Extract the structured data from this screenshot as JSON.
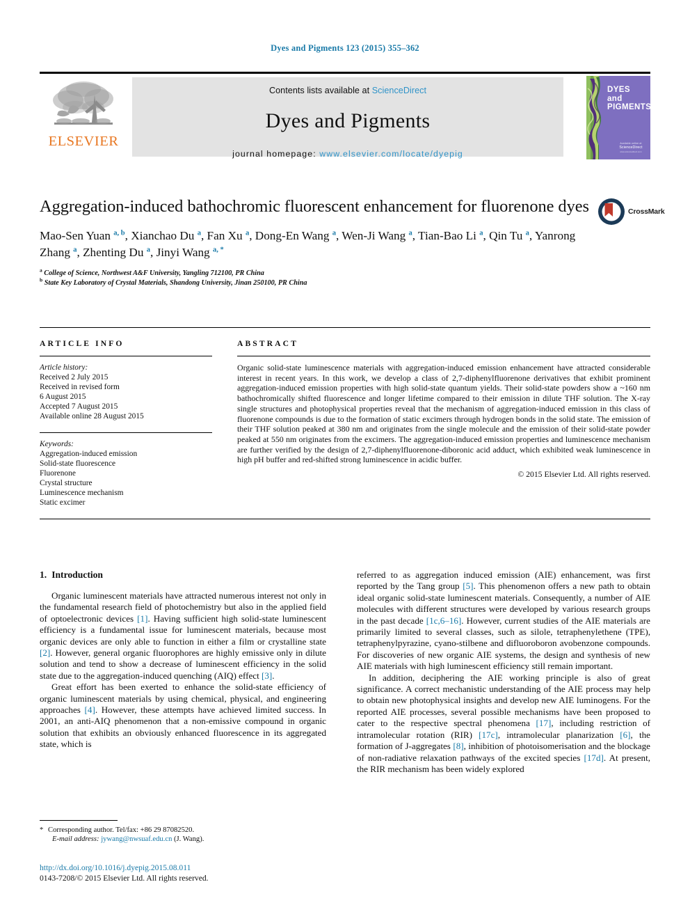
{
  "running_head": "Dyes and Pigments 123 (2015) 355–362",
  "masthead": {
    "contents_prefix": "Contents lists available at ",
    "sciencedirect": "ScienceDirect",
    "journal_title": "Dyes and Pigments",
    "homepage_prefix": "journal homepage: ",
    "homepage_url": "www.elsevier.com/locate/dyepig",
    "publisher_name": "ELSEVIER",
    "cover": {
      "line1": "DYES",
      "line2": "and",
      "line3": "PIGMENTS",
      "foot_a": "Available online at",
      "foot_b": "ScienceDirect",
      "foot_c": "www.sciencedirect.com"
    }
  },
  "article": {
    "title": "Aggregation-induced bathochromic fluorescent enhancement for fluorenone dyes",
    "authors": [
      {
        "name": "Mao-Sen Yuan",
        "sup": "a, b",
        "sep": ", "
      },
      {
        "name": "Xianchao Du",
        "sup": "a",
        "sep": ", "
      },
      {
        "name": "Fan Xu",
        "sup": "a",
        "sep": ", "
      },
      {
        "name": "Dong-En Wang",
        "sup": "a",
        "sep": ", "
      },
      {
        "name": "Wen-Ji Wang",
        "sup": "a",
        "sep": ", "
      },
      {
        "name": "Tian-Bao Li",
        "sup": "a",
        "sep": ", "
      },
      {
        "name": "Qin Tu",
        "sup": "a",
        "sep": ", "
      },
      {
        "name": "Yanrong Zhang",
        "sup": "a",
        "sep": ", "
      },
      {
        "name": "Zhenting Du",
        "sup": "a",
        "sep": ", "
      },
      {
        "name": "Jinyi Wang",
        "sup": "a, *",
        "sep": ""
      }
    ],
    "affiliations": [
      {
        "mark": "a",
        "text": "College of Science, Northwest A&F University, Yangling 712100, PR China"
      },
      {
        "mark": "b",
        "text": "State Key Laboratory of Crystal Materials, Shandong University, Jinan 250100, PR China"
      }
    ],
    "crossmark_label": "CrossMark"
  },
  "info": {
    "heading": "ARTICLE INFO",
    "history_label": "Article history:",
    "history": [
      "Received 2 July 2015",
      "Received in revised form",
      "6 August 2015",
      "Accepted 7 August 2015",
      "Available online 28 August 2015"
    ],
    "keywords_label": "Keywords:",
    "keywords": [
      "Aggregation-induced emission",
      "Solid-state fluorescence",
      "Fluorenone",
      "Crystal structure",
      "Luminescence mechanism",
      "Static excimer"
    ]
  },
  "abstract": {
    "heading": "ABSTRACT",
    "text": "Organic solid-state luminescence materials with aggregation-induced emission enhancement have attracted considerable interest in recent years. In this work, we develop a class of 2,7-diphenylfluorenone derivatives that exhibit prominent aggregation-induced emission properties with high solid-state quantum yields. Their solid-state powders show a ~160 nm bathochromically shifted fluorescence and longer lifetime compared to their emission in dilute THF solution. The X-ray single structures and photophysical properties reveal that the mechanism of aggregation-induced emission in this class of fluorenone compounds is due to the formation of static excimers through hydrogen bonds in the solid state. The emission of their THF solution peaked at 380 nm and originates from the single molecule and the emission of their solid-state powder peaked at 550 nm originates from the excimers. The aggregation-induced emission properties and luminescence mechanism are further verified by the design of 2,7-diphenylfluorenone-diboronic acid adduct, which exhibited weak luminescence in high pH buffer and red-shifted strong luminescence in acidic buffer.",
    "copyright": "© 2015 Elsevier Ltd. All rights reserved."
  },
  "body": {
    "section_number": "1.",
    "section_title": "Introduction",
    "left_paragraphs": [
      "Organic luminescent materials have attracted numerous interest not only in the fundamental research field of photochemistry but also in the applied field of optoelectronic devices [1]. Having sufficient high solid-state luminescent efficiency is a fundamental issue for luminescent materials, because most organic devices are only able to function in either a film or crystalline state [2]. However, general organic fluorophores are highly emissive only in dilute solution and tend to show a decrease of luminescent efficiency in the solid state due to the aggregation-induced quenching (AIQ) effect [3].",
      "Great effort has been exerted to enhance the solid-state efficiency of organic luminescent materials by using chemical, physical, and engineering approaches [4]. However, these attempts have achieved limited success. In 2001, an anti-AIQ phenomenon that a non-emissive compound in organic solution that exhibits an obviously enhanced fluorescence in its aggregated state, which is"
    ],
    "right_paragraphs": [
      "referred to as aggregation induced emission (AIE) enhancement, was first reported by the Tang group [5]. This phenomenon offers a new path to obtain ideal organic solid-state luminescent materials. Consequently, a number of AIE molecules with different structures were developed by various research groups in the past decade [1c,6–16]. However, current studies of the AIE materials are primarily limited to several classes, such as silole, tetraphenylethene (TPE), tetraphenylpyrazine, cyano-stilbene and difluoroboron avobenzone compounds. For discoveries of new organic AIE systems, the design and synthesis of new AIE materials with high luminescent efficiency still remain important.",
      "In addition, deciphering the AIE working principle is also of great significance. A correct mechanistic understanding of the AIE process may help to obtain new photophysical insights and develop new AIE luminogens. For the reported AIE processes, several possible mechanisms have been proposed to cater to the respective spectral phenomena [17], including restriction of intramolecular rotation (RIR) [17c], intramolecular planarization [6], the formation of J-aggregates [8], inhibition of photoisomerisation and the blockage of non-radiative relaxation pathways of the excited species [17d]. At present, the RIR mechanism has been widely explored"
    ]
  },
  "footnotes": {
    "corresponding_star": "*",
    "corresponding": "Corresponding author. Tel/fax: +86 29 87082520.",
    "email_label": "E-mail address:",
    "email": "jywang@nwsuaf.edu.cn",
    "email_suffix": "(J. Wang).",
    "doi": "http://dx.doi.org/10.1016/j.dyepig.2015.08.011",
    "issn": "0143-7208/© 2015 Elsevier Ltd. All rights reserved."
  },
  "colors": {
    "link": "#1a7aa8",
    "sciencedirect": "#2f93c8",
    "elsevier_orange": "#E87722",
    "cover_purple": "#7e6fc0",
    "masthead_grey": "#e3e3e3"
  }
}
